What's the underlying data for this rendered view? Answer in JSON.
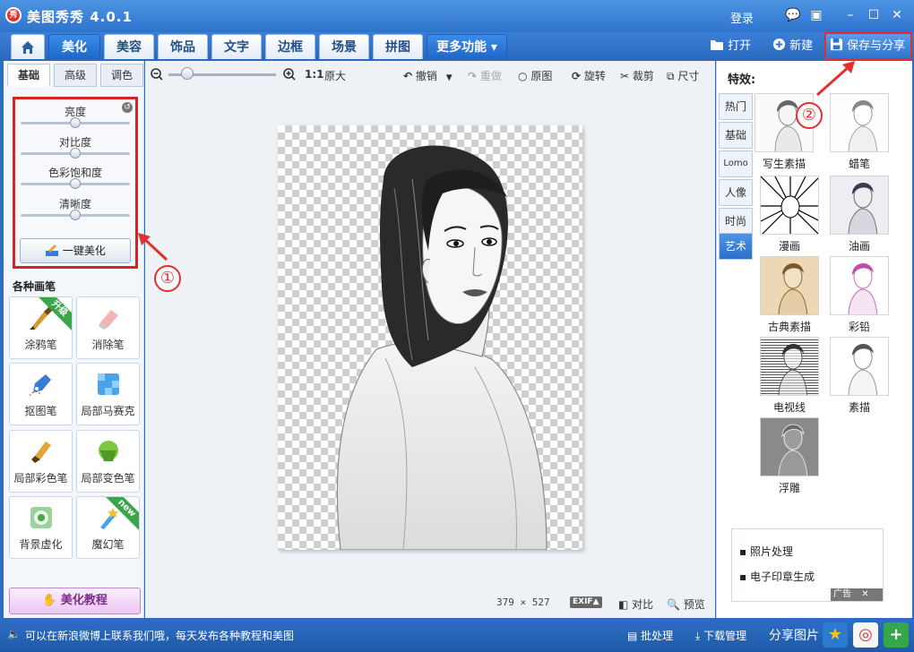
{
  "app": {
    "title": "美图秀秀 4.0.1",
    "logo": "秀",
    "login": "登录"
  },
  "window_controls": {
    "message": "💬",
    "skin": "▣",
    "minimize": "–",
    "maximize": "☐",
    "close": "✕"
  },
  "main_tabs": [
    {
      "label": "美化",
      "active": true
    },
    {
      "label": "美容"
    },
    {
      "label": "饰品"
    },
    {
      "label": "文字"
    },
    {
      "label": "边框"
    },
    {
      "label": "场景"
    },
    {
      "label": "拼图"
    }
  ],
  "more_tab": "更多功能 ▾",
  "header_actions": {
    "open": "打开",
    "new": "新建",
    "save_share": "保存与分享"
  },
  "left": {
    "subtabs": [
      "基础",
      "高级",
      "调色"
    ],
    "sliders": [
      {
        "label": "亮度",
        "value": 0.5
      },
      {
        "label": "对比度",
        "value": 0.5
      },
      {
        "label": "色彩饱和度",
        "value": 0.5
      },
      {
        "label": "清晰度",
        "value": 0.5
      }
    ],
    "onekey": "一键美化",
    "brushes_title": "各种画笔",
    "brushes": [
      {
        "label": "涂鸦笔",
        "ribbon": "升级"
      },
      {
        "label": "消除笔"
      },
      {
        "label": "抠图笔"
      },
      {
        "label": "局部马赛克"
      },
      {
        "label": "局部彩色笔"
      },
      {
        "label": "局部变色笔"
      },
      {
        "label": "背景虚化"
      },
      {
        "label": "魔幻笔",
        "ribbon": "new"
      }
    ],
    "tutorial": "美化教程"
  },
  "toolbar": {
    "zoom_ratio": "1:1",
    "original_size": "原大",
    "undo": "撤销",
    "redo": "重做",
    "original": "原图",
    "rotate": "旋转",
    "crop": "裁剪",
    "size": "尺寸"
  },
  "canvas": {
    "width_text": "379",
    "x": "×",
    "height_text": "527",
    "exif": "EXIF▲",
    "compare": "对比",
    "preview": "预览"
  },
  "right": {
    "title": "特效:",
    "categories": [
      "热门",
      "基础",
      "Lomo",
      "人像",
      "时尚",
      "艺术"
    ],
    "active_category": 5,
    "effects": [
      "写生素描",
      "蜡笔",
      "漫画",
      "油画",
      "古典素描",
      "彩铅",
      "电视线",
      "素描",
      "浮雕"
    ],
    "ad_links": [
      "照片处理",
      "电子印章生成"
    ],
    "ad_badge": "广告"
  },
  "status": {
    "message": "可以在新浪微博上联系我们哦，每天发布各种教程和美图",
    "batch": "批处理",
    "download": "下载管理",
    "share": "分享图片"
  },
  "annotations": [
    "①",
    "②"
  ],
  "colors": {
    "accent": "#2f74cc",
    "highlight": "#e23030"
  }
}
